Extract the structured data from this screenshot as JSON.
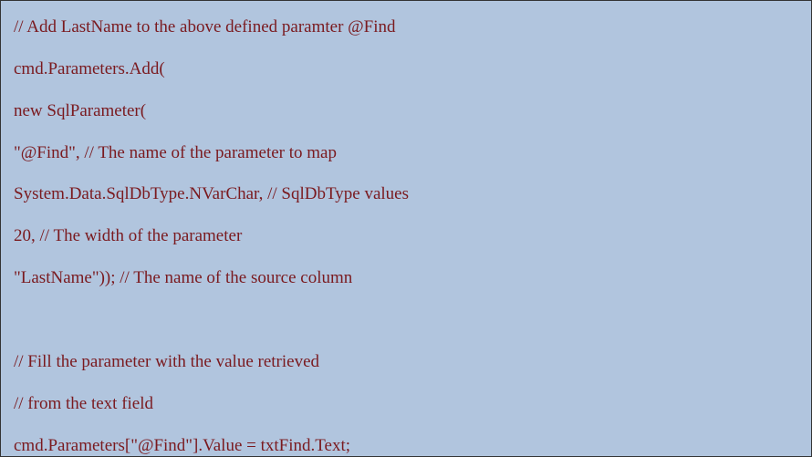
{
  "code": {
    "line1": "// Add LastName to the above defined paramter @Find",
    "line2": "cmd.Parameters.Add(",
    "line3": "new SqlParameter(",
    "line4": "\"@Find\", // The name of the parameter to map",
    "line5": "System.Data.SqlDbType.NVarChar, // SqlDbType values",
    "line6": "20, // The width of the parameter",
    "line7": "\"LastName\")); // The name of the source column",
    "line8": "// Fill the parameter with the value retrieved",
    "line9": "// from the text field",
    "line10": "cmd.Parameters[\"@Find\"].Value = txtFind.Text;"
  }
}
